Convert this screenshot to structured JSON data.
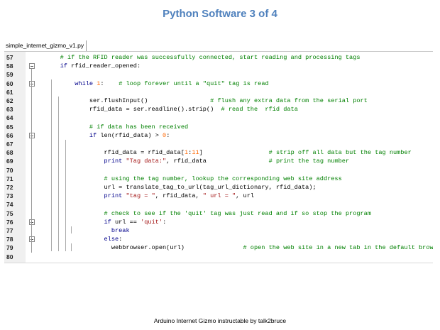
{
  "slide_title": "Python Software 3 of 4",
  "tab": {
    "filename": "simple_internet_gizmo_v1.py"
  },
  "code_lines": [
    {
      "num": "57",
      "text": "    # if the RFID reader was successfully connected, start reading and processing tags"
    },
    {
      "num": "58",
      "text": "    if rfid_reader_opened:"
    },
    {
      "num": "59",
      "text": ""
    },
    {
      "num": "60",
      "text": "        while 1:    # loop forever until a \"quit\" tag is read"
    },
    {
      "num": "61",
      "text": ""
    },
    {
      "num": "62",
      "text": "            ser.flushInput()                 # flush any extra data from the serial port"
    },
    {
      "num": "63",
      "text": "            rfid_data = ser.readline().strip()  # read the  rfid data"
    },
    {
      "num": "64",
      "text": ""
    },
    {
      "num": "65",
      "text": "            # if data has been received"
    },
    {
      "num": "66",
      "text": "            if len(rfid_data) > 0:"
    },
    {
      "num": "67",
      "text": ""
    },
    {
      "num": "68",
      "text": "                rfid_data = rfid_data[1:11]                  # strip off all data but the tag number"
    },
    {
      "num": "69",
      "text": "                print \"Tag data:\", rfid_data                 # print the tag number"
    },
    {
      "num": "70",
      "text": ""
    },
    {
      "num": "71",
      "text": "                # using the tag number, lookup the corresponding web site address"
    },
    {
      "num": "72",
      "text": "                url = translate_tag_to_url(tag_url_dictionary, rfid_data);"
    },
    {
      "num": "73",
      "text": "                print \"tag = \", rfid_data, \" url = \", url"
    },
    {
      "num": "74",
      "text": ""
    },
    {
      "num": "75",
      "text": "                # check to see if the 'quit' tag was just read and if so stop the program"
    },
    {
      "num": "76",
      "text": "                if url == 'quit':"
    },
    {
      "num": "77",
      "text": "                  break"
    },
    {
      "num": "78",
      "text": "                else:"
    },
    {
      "num": "79",
      "text": "                  webbrowser.open(url)                # open the web site in a new tab in the default browser"
    },
    {
      "num": "80",
      "text": ""
    }
  ],
  "caption": "Arduino Internet  Gizmo instructable by talk2bruce",
  "colors": {
    "title": "#4f81bd",
    "comment": "#008000",
    "keyword": "#00008b",
    "string": "#a31515",
    "number": "#ff6600",
    "gutter": "#f0f0f0"
  }
}
